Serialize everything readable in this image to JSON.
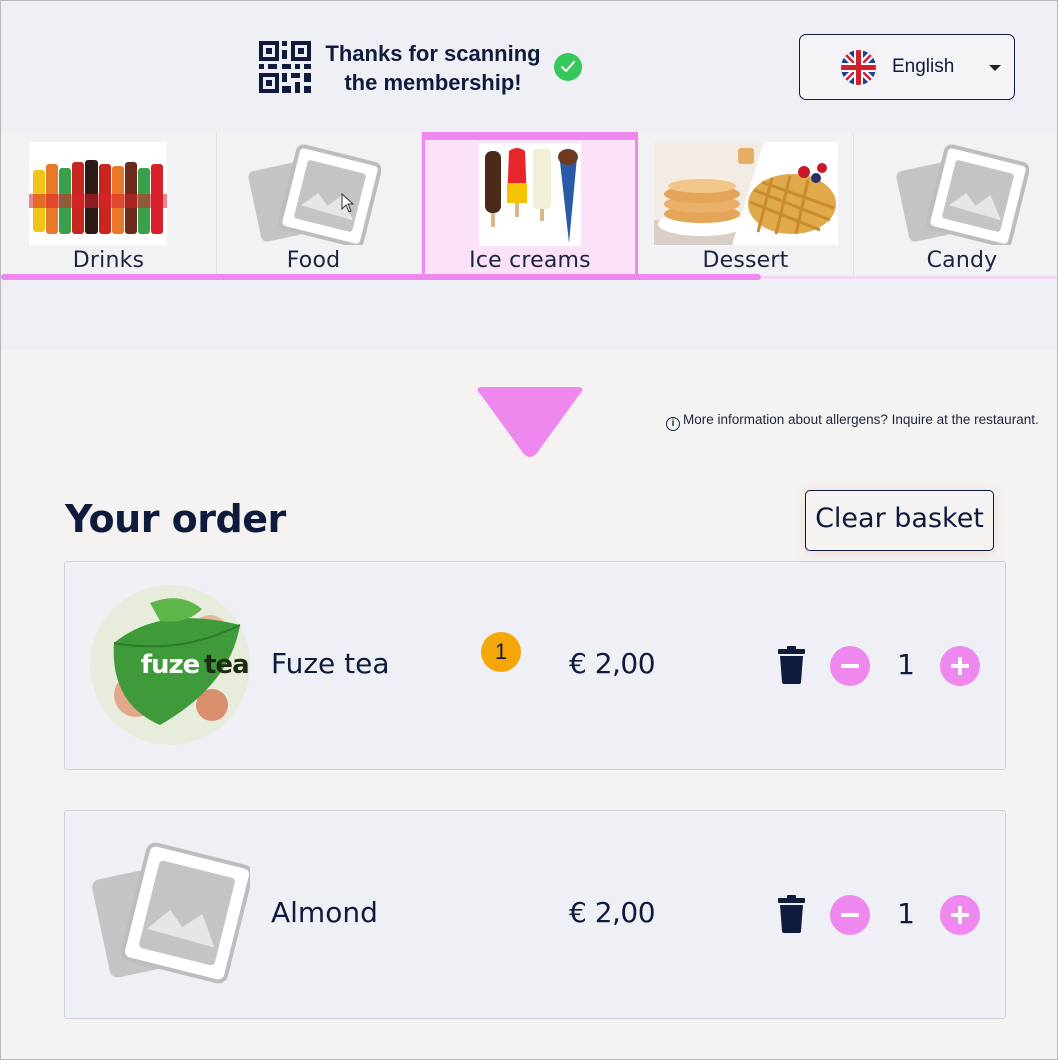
{
  "header": {
    "scan_message": "Thanks for scanning the membership!",
    "language": {
      "selected": "English",
      "flag": "uk-flag-icon"
    }
  },
  "categories": [
    {
      "label": "Drinks",
      "image": "drinks-photo",
      "selected": false
    },
    {
      "label": "Food",
      "image": "placeholder-image-icon",
      "selected": false
    },
    {
      "label": "Ice creams",
      "image": "ice-cream-photo",
      "selected": true
    },
    {
      "label": "Dessert",
      "image": "dessert-photo",
      "selected": false
    },
    {
      "label": "Candy",
      "image": "placeholder-image-icon",
      "selected": false
    }
  ],
  "allergen_info": "More information about allergens? Inquire at the restaurant.",
  "order": {
    "title": "Your order",
    "clear_label": "Clear basket",
    "items": [
      {
        "name": "Fuze tea",
        "image": "fuzetea-logo",
        "badge": "1",
        "price": "€ 2,00",
        "quantity": "1"
      },
      {
        "name": "Almond",
        "image": "placeholder-image-icon",
        "badge": "",
        "price": "€ 2,00",
        "quantity": "1"
      }
    ]
  },
  "colors": {
    "accent": "#ee88ee",
    "navy": "#0f1b3d",
    "badge": "#f5a70a",
    "success": "#35c759",
    "selected_bg": "#fbe2f8"
  }
}
